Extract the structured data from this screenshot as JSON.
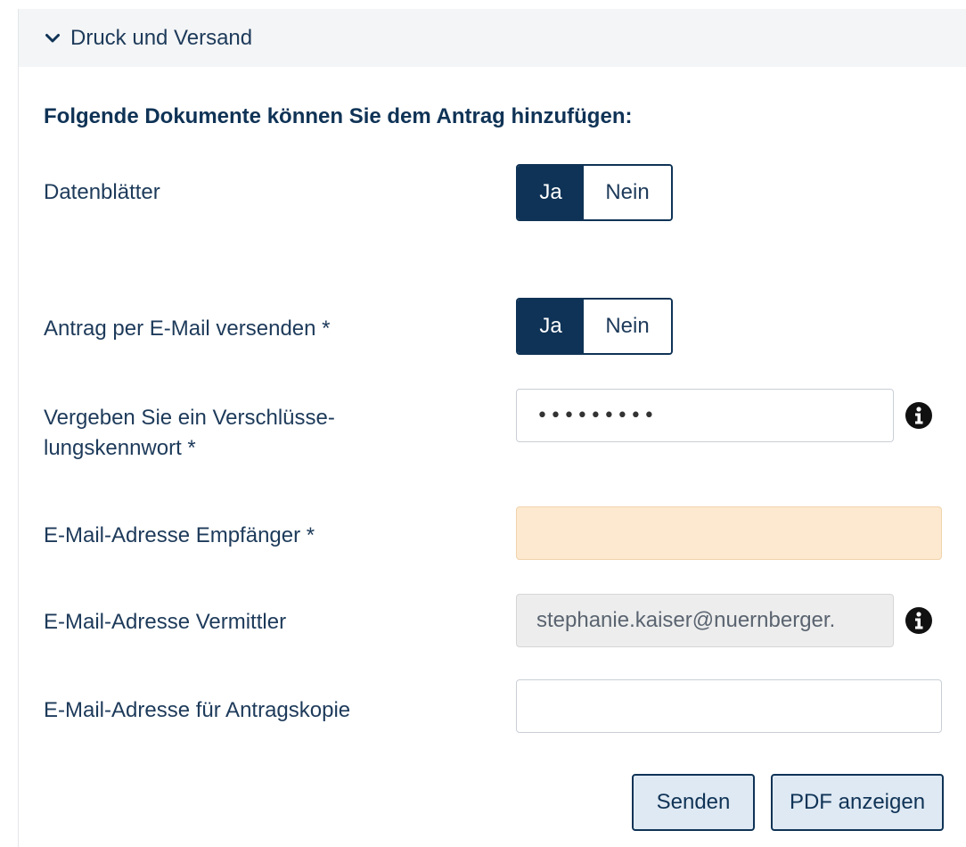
{
  "panel": {
    "title": "Druck und Versand",
    "chevron_icon": "chevron-down-icon"
  },
  "section": {
    "heading": "Folgende Dokumente können Sie dem Antrag hinzufügen:"
  },
  "rows": {
    "datenblaetter": {
      "label": "Datenblätter",
      "yes_label": "Ja",
      "no_label": "Nein",
      "selected": "Ja"
    },
    "email_versand": {
      "label": "Antrag per E-Mail versenden *",
      "yes_label": "Ja",
      "no_label": "Nein",
      "selected": "Ja"
    },
    "kennwort": {
      "label_line1": "Vergeben Sie ein Verschlüsse-",
      "label_line2": "lungskennwort *",
      "value": "•••••••••",
      "info_icon": "info-icon"
    },
    "empfaenger": {
      "label": "E-Mail-Adresse Empfänger *",
      "value": ""
    },
    "vermittler": {
      "label": "E-Mail-Adresse Vermittler",
      "value": "stephanie.kaiser@nuernberger.",
      "info_icon": "info-icon"
    },
    "kopie": {
      "label": "E-Mail-Adresse für Antragskopie",
      "value": ""
    }
  },
  "actions": {
    "send_label": "Senden",
    "pdf_label": "PDF anzeigen"
  },
  "colors": {
    "primary": "#0f3356",
    "text": "#1d3a5a",
    "warning_bg": "#fde9cf",
    "readonly_bg": "#ededed",
    "button_bg": "#dfe9f3"
  }
}
